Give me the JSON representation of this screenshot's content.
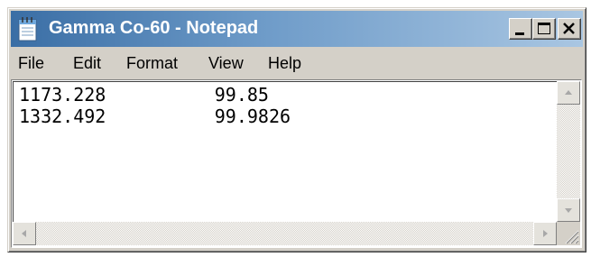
{
  "window": {
    "title": "Gamma Co-60 - Notepad",
    "icon": "notepad-icon"
  },
  "controls": {
    "minimize_icon": "minimize-icon",
    "maximize_icon": "maximize-icon",
    "close_icon": "close-icon"
  },
  "menu": {
    "items": [
      {
        "label": "File"
      },
      {
        "label": "Edit"
      },
      {
        "label": "Format"
      },
      {
        "label": "View"
      },
      {
        "label": "Help"
      }
    ]
  },
  "editor": {
    "lines": [
      {
        "text": "1173.228          99.85"
      },
      {
        "text": "1332.492          99.9826"
      }
    ]
  },
  "colors": {
    "title_bar_start": "#3a6ea5",
    "title_bar_end": "#a9c6e2",
    "face": "#d4d0c8"
  }
}
